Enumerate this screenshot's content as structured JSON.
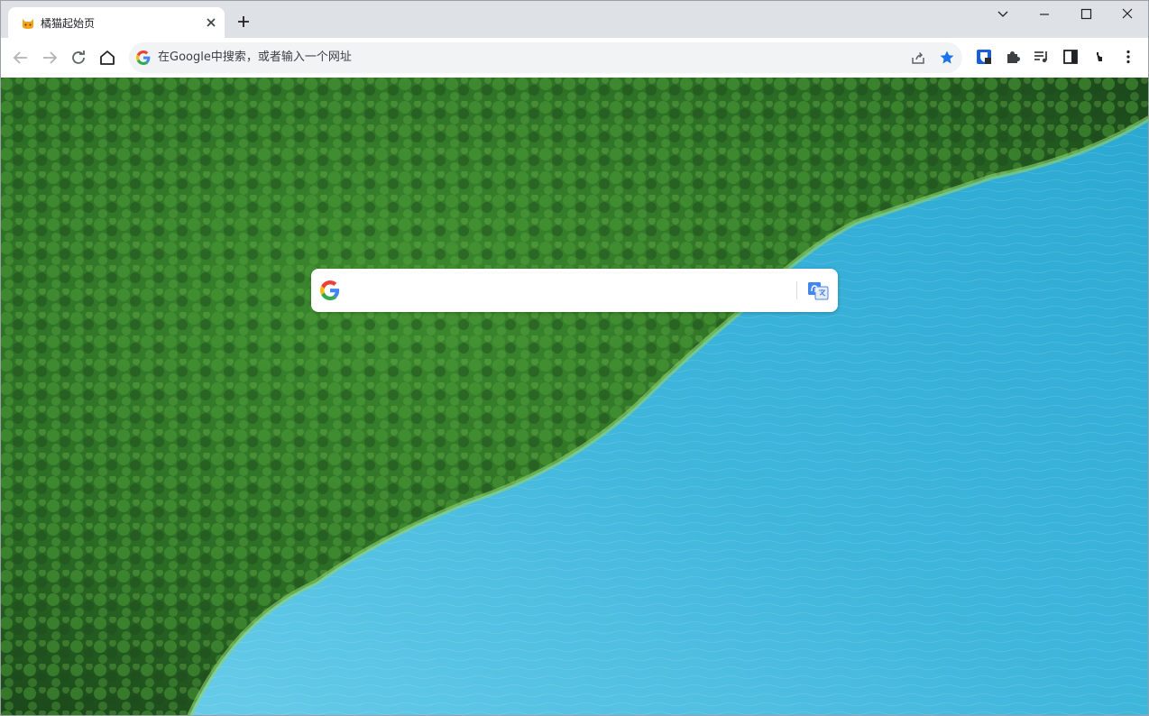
{
  "tab": {
    "title": "橘猫起始页"
  },
  "omnibox": {
    "placeholder": "在Google中搜索，或者输入一个网址"
  },
  "page": {
    "search_placeholder": ""
  },
  "colors": {
    "titlebar": "#dee1e6",
    "bookmark_star": "#1a73e8",
    "water": "#3fb3d8",
    "forest": "#2d6b2a"
  },
  "icons": [
    "cat-favicon",
    "close-icon",
    "plus-icon",
    "chevron-down-icon",
    "minimize-icon",
    "maximize-icon",
    "window-close-icon",
    "back-icon",
    "forward-icon",
    "reload-icon",
    "home-icon",
    "google-icon",
    "share-icon",
    "star-icon",
    "bitwarden-icon",
    "puzzle-icon",
    "media-icon",
    "side-panel-icon",
    "profile-icon",
    "menu-icon",
    "translate-icon"
  ]
}
